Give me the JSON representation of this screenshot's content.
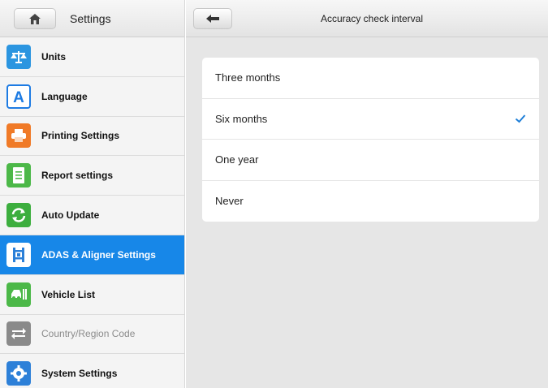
{
  "sidebar": {
    "title": "Settings",
    "items": [
      {
        "label": "Units",
        "icon": "scale-icon",
        "color": "#2b95e0"
      },
      {
        "label": "Language",
        "icon": "letter-a-icon",
        "color": "#1d7be3"
      },
      {
        "label": "Printing Settings",
        "icon": "printer-icon",
        "color": "#f07a27"
      },
      {
        "label": "Report settings",
        "icon": "report-icon",
        "color": "#4cb848"
      },
      {
        "label": "Auto Update",
        "icon": "refresh-icon",
        "color": "#3cae3e"
      },
      {
        "label": "ADAS & Aligner Settings",
        "icon": "adas-icon",
        "color": "#2a7fd8"
      },
      {
        "label": "Vehicle List",
        "icon": "vehicle-list-icon",
        "color": "#4cb848"
      },
      {
        "label": "Country/Region Code",
        "icon": "arrows-icon",
        "color": "#8a8a8a"
      },
      {
        "label": "System Settings",
        "icon": "gear-icon",
        "color": "#2d80d8"
      }
    ]
  },
  "main": {
    "title": "Accuracy check interval",
    "options": [
      {
        "label": "Three months",
        "selected": false
      },
      {
        "label": "Six months",
        "selected": true
      },
      {
        "label": "One year",
        "selected": false
      },
      {
        "label": "Never",
        "selected": false
      }
    ]
  },
  "colors": {
    "accent": "#1787e8",
    "check": "#1f7fd8"
  }
}
